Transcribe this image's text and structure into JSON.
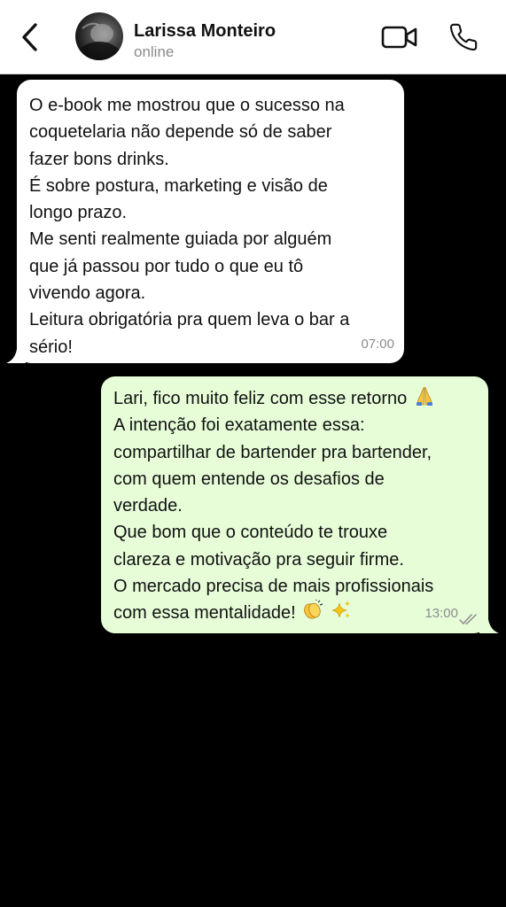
{
  "header": {
    "contact_name": "Larissa Monteiro",
    "status": "online",
    "icons": [
      "chevron-left-icon",
      "video-camera-icon",
      "phone-icon"
    ]
  },
  "messages": [
    {
      "direction": "incoming",
      "lines": [
        "O e-book me mostrou que o sucesso na",
        "coquetelaria não depende só de saber",
        "fazer bons drinks.",
        "É sobre postura, marketing e visão de",
        "longo prazo.",
        "Me senti realmente guiada por alguém",
        "que já passou por tudo o que eu tô",
        "vivendo agora.",
        "Leitura obrigatória pra quem leva o bar a",
        "sério!"
      ],
      "time": "07:00"
    },
    {
      "direction": "outgoing",
      "lines": [
        "Lari, fico muito feliz com esse retorno",
        "A intenção foi exatamente essa:",
        "compartilhar de bartender pra bartender,",
        "com quem entende os desafios de",
        "verdade.",
        "Que bom que o conteúdo te trouxe",
        "clareza e motivação pra seguir firme.",
        "O mercado precisa de mais profissionais",
        "com essa mentalidade!"
      ],
      "emojis": [
        "praying-hands-icon",
        "clapping-hands-icon",
        "sparkles-icon"
      ],
      "time": "13:00",
      "read_status": "read"
    }
  ],
  "colors": {
    "chat_background": "#000000",
    "incoming_bubble": "#ffffff",
    "outgoing_bubble": "#e6fdd8",
    "timestamp": "#8c8c8c"
  }
}
